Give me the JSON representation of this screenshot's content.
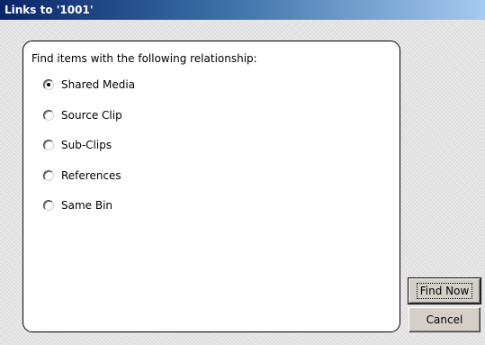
{
  "window": {
    "title": "Links to '1001'"
  },
  "group": {
    "label": "Find items with the following relationship:",
    "options": [
      {
        "label": "Shared Media",
        "selected": true
      },
      {
        "label": "Source Clip",
        "selected": false
      },
      {
        "label": "Sub-Clips",
        "selected": false
      },
      {
        "label": "References",
        "selected": false
      },
      {
        "label": "Same Bin",
        "selected": false
      }
    ]
  },
  "buttons": {
    "find_now": "Find Now",
    "cancel": "Cancel"
  },
  "colors": {
    "titlebar_start": "#0a246a",
    "titlebar_end": "#a6caf0",
    "dialog_background": "#e3e3e3",
    "button_face": "#d4d0c8"
  }
}
